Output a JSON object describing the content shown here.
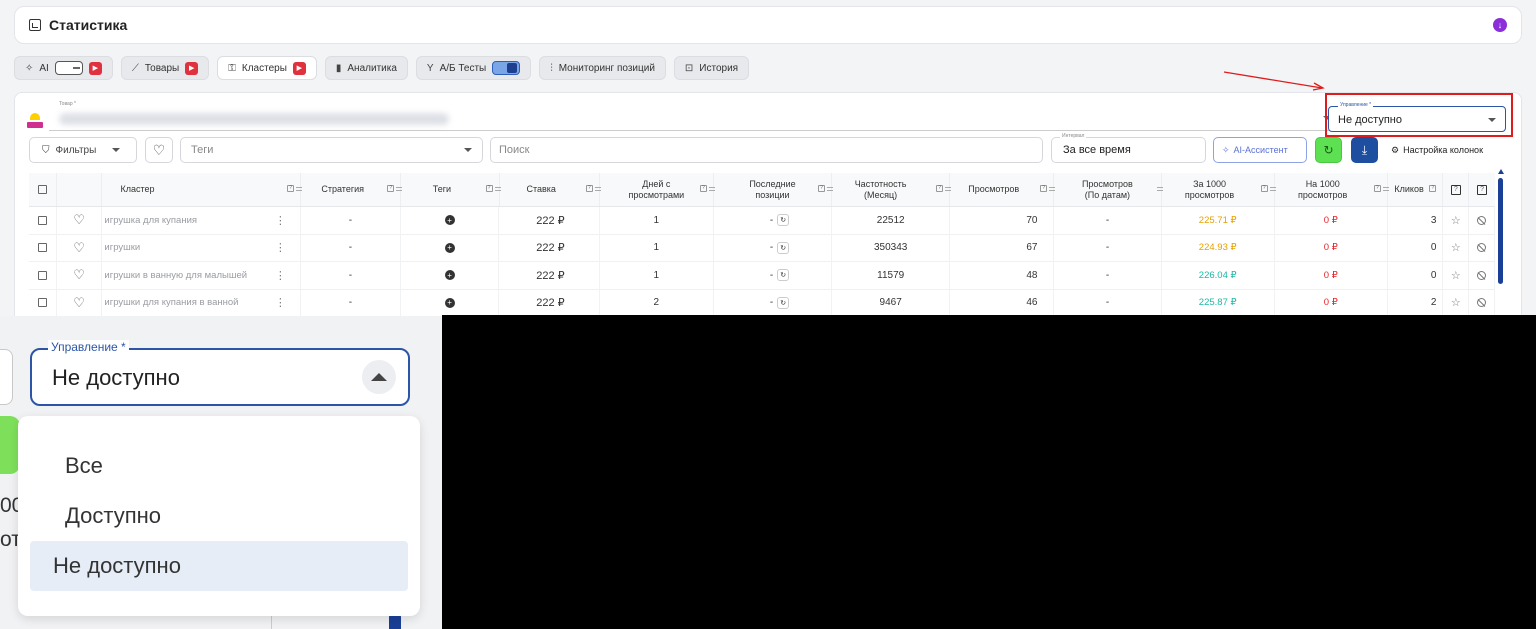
{
  "header": {
    "title": "Статистика"
  },
  "tabs": [
    {
      "label": "AI",
      "icon": "sparkle-icon"
    },
    {
      "label": "Товары",
      "icon": "chart-line-icon"
    },
    {
      "label": "Кластеры",
      "icon": "key-icon"
    },
    {
      "label": "Аналитика",
      "icon": "bar-chart-icon"
    },
    {
      "label": "А/Б Тесты",
      "icon": "ab-split-icon"
    },
    {
      "label": "Мониторинг позиций",
      "icon": "sliders-icon"
    },
    {
      "label": "История",
      "icon": "history-icon"
    }
  ],
  "product_field": {
    "label": "Товар *"
  },
  "control_field": {
    "label": "Управление *",
    "value": "Не доступно"
  },
  "toolbar": {
    "filters": "Фильтры",
    "tags_placeholder": "Теги",
    "search_placeholder": "Поиск",
    "interval_label": "Интервал",
    "interval_value": "За все время",
    "ai_assistant": "AI-Ассистент",
    "column_settings": "Настройка колонок"
  },
  "table": {
    "headers": {
      "cluster": "Кластер",
      "strategy": "Стратегия",
      "tags": "Теги",
      "bid": "Ставка",
      "days_views": "Дней с просмотрами",
      "last_positions": "Последние позиции",
      "frequency": "Частотность (Месяц)",
      "views": "Просмотров",
      "views_by_dates": "Просмотров (По датам)",
      "per_1000": "За 1000 просмотров",
      "on_1000": "На 1000 просмотров",
      "clicks": "Кликов",
      "help1": "?",
      "help2": "?"
    },
    "rows": [
      {
        "cluster": "игрушка для купания",
        "strategy": "-",
        "bid": "222 ₽",
        "days": "1",
        "pos": "-",
        "freq": "22512",
        "views": "70",
        "views_dates": "-",
        "per1000": "225.71 ₽",
        "per1000_color": "#e6a100",
        "on1000": "0 ₽",
        "clicks": "3"
      },
      {
        "cluster": "игрушки",
        "strategy": "-",
        "bid": "222 ₽",
        "days": "1",
        "pos": "-",
        "freq": "350343",
        "views": "67",
        "views_dates": "-",
        "per1000": "224.93 ₽",
        "per1000_color": "#e6a100",
        "on1000": "0 ₽",
        "clicks": "0"
      },
      {
        "cluster": "игрушки в ванную для малышей",
        "strategy": "-",
        "bid": "222 ₽",
        "days": "1",
        "pos": "-",
        "freq": "11579",
        "views": "48",
        "views_dates": "-",
        "per1000": "226.04 ₽",
        "per1000_color": "#1eb8a5",
        "on1000": "0 ₽",
        "clicks": "0"
      },
      {
        "cluster": "игрушки для купания в ванной",
        "strategy": "-",
        "bid": "222 ₽",
        "days": "2",
        "pos": "-",
        "freq": "9467",
        "views": "46",
        "views_dates": "-",
        "per1000": "225.87 ₽",
        "per1000_color": "#1eb8a5",
        "on1000": "0 ₽",
        "clicks": "2"
      }
    ]
  },
  "zoom": {
    "label": "Управление *",
    "value": "Не доступно",
    "options": [
      "Все",
      "Доступно",
      "Не доступно"
    ],
    "selected": "Не доступно",
    "cut_text_1": "00",
    "cut_text_2": "от"
  },
  "colors": {
    "accent": "#2c55a8",
    "highlight": "#e01b1b",
    "green": "#5de052",
    "download": "#1e4ea0"
  }
}
